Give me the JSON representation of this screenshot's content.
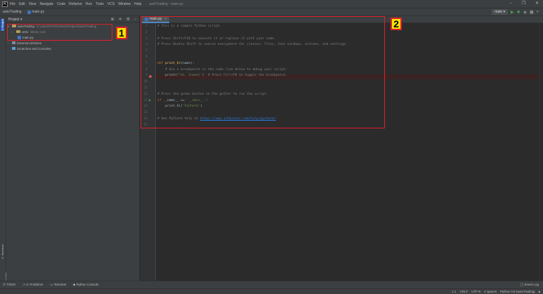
{
  "app": {
    "window_title": "autoTrading - main.py",
    "menu": [
      "File",
      "Edit",
      "View",
      "Navigate",
      "Code",
      "Refactor",
      "Run",
      "Tools",
      "VCS",
      "Window",
      "Help"
    ]
  },
  "navbar": {
    "project": "autoTrading",
    "file": "main.py",
    "run_config": "main"
  },
  "left_strip": {
    "project_tab": "1: Project",
    "structure_tab": "Z: Structure",
    "favorites_tab": "2: Favorites"
  },
  "project_panel": {
    "title": "Project",
    "tree": {
      "root_name": "autoTrading",
      "root_path": "C:\\Users\\PC\\PycharmProjects\\autoTrading",
      "venv_name": "venv",
      "venv_note": "library root",
      "main_file": "main.py",
      "external_libraries": "External Libraries",
      "scratches": "Scratches and Consoles"
    }
  },
  "editor": {
    "tab_label": "main.py",
    "line_numbers": [
      "1",
      "2",
      "3",
      "4",
      "5",
      "6",
      "7",
      "8",
      "9",
      "10",
      "11",
      "12",
      "13",
      "14",
      "15",
      "16",
      "17"
    ],
    "lines": {
      "l1": "# This is a sample Python script.",
      "l3": "# Press Shift+F10 to execute it or replace it with your code.",
      "l4": "# Press Double Shift to search everywhere for classes, files, tool windows, actions, and settings.",
      "l7_kw": "def ",
      "l7_fn": "print_hi",
      "l7_rest": "(name):",
      "l8": "    # Use a breakpoint in the code line below to debug your script.",
      "l9_a": "    print(",
      "l9_str": "f'Hi, {name}'",
      "l9_b": ")  ",
      "l9_comment": "# Press Ctrl+F8 to toggle the breakpoint.",
      "l12": "# Press the green button in the gutter to run the script.",
      "l13_kw": "if ",
      "l13_mid": "__name__ == ",
      "l13_str": "'__main__'",
      "l13_end": ":",
      "l14_a": "    print_hi(",
      "l14_str": "'PyCharm'",
      "l14_b": ")",
      "l16_comment": "# See PyCharm help at ",
      "l16_url": "https://www.jetbrains.com/help/pycharm/"
    }
  },
  "annotations": {
    "label_1": "1",
    "label_2": "2"
  },
  "bottom_bar": {
    "todo": "TODO",
    "problems": "6: Problems",
    "terminal": "Terminal",
    "python_console": "Python Console",
    "event_log": "Event Log"
  },
  "status_bar": {
    "position": "1:1",
    "line_sep": "CRLF",
    "encoding": "UTF-8",
    "indent": "4 spaces",
    "interpreter": "Python 3.8 (autoTrading)"
  }
}
